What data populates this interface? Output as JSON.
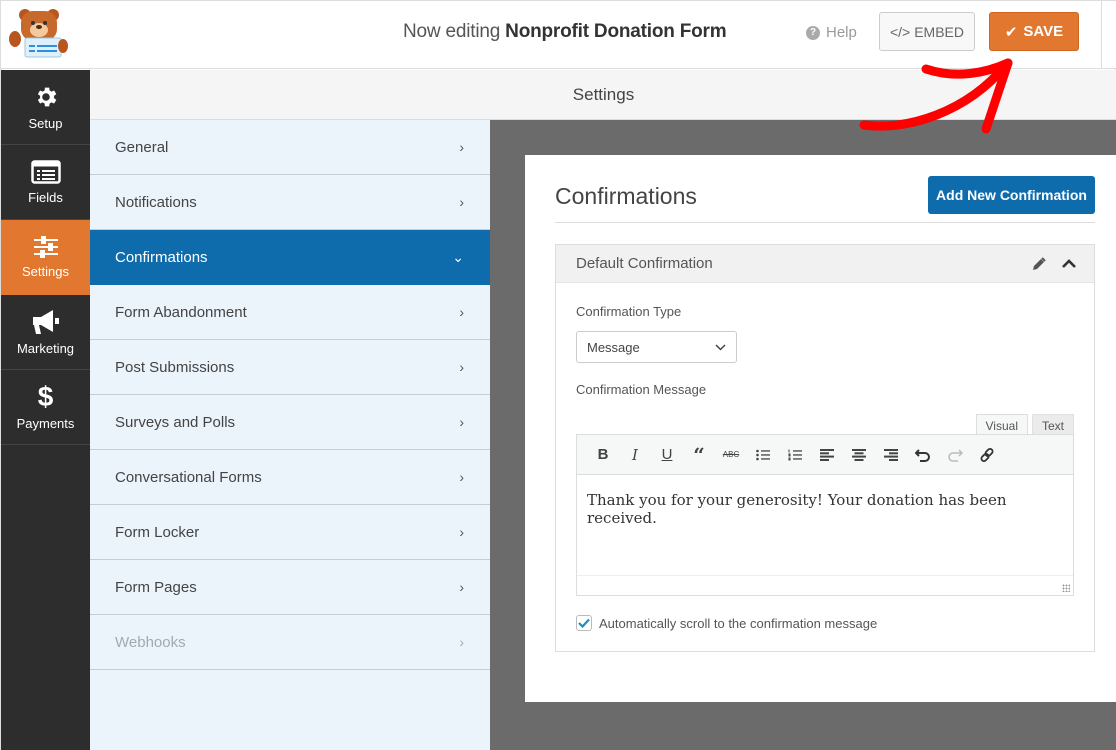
{
  "header": {
    "title_prefix": "Now editing",
    "form_name": "Nonprofit Donation Form",
    "help_label": "Help",
    "embed_label": "EMBED",
    "save_label": "SAVE"
  },
  "leftnav": {
    "items": [
      {
        "label": "Setup",
        "icon": "gear-icon",
        "active": false
      },
      {
        "label": "Fields",
        "icon": "fields-icon",
        "active": false
      },
      {
        "label": "Settings",
        "icon": "sliders-icon",
        "active": true
      },
      {
        "label": "Marketing",
        "icon": "megaphone-icon",
        "active": false
      },
      {
        "label": "Payments",
        "icon": "dollar-icon",
        "active": false
      }
    ]
  },
  "settings": {
    "heading": "Settings",
    "panels": [
      {
        "label": "General",
        "state": "normal"
      },
      {
        "label": "Notifications",
        "state": "normal"
      },
      {
        "label": "Confirmations",
        "state": "active"
      },
      {
        "label": "Form Abandonment",
        "state": "normal"
      },
      {
        "label": "Post Submissions",
        "state": "normal"
      },
      {
        "label": "Surveys and Polls",
        "state": "normal"
      },
      {
        "label": "Conversational Forms",
        "state": "normal"
      },
      {
        "label": "Form Locker",
        "state": "normal"
      },
      {
        "label": "Form Pages",
        "state": "normal"
      },
      {
        "label": "Webhooks",
        "state": "disabled"
      }
    ]
  },
  "confirmations": {
    "title": "Confirmations",
    "add_button": "Add New Confirmation",
    "default": {
      "title": "Default Confirmation",
      "type_label": "Confirmation Type",
      "type_value": "Message",
      "message_label": "Confirmation Message",
      "editor_tabs": [
        "Visual",
        "Text"
      ],
      "active_tab": "Visual",
      "message_text": "Thank you for your generosity! Your donation has been received.",
      "auto_scroll_label": "Automatically scroll to the confirmation message",
      "auto_scroll_checked": true
    }
  },
  "colors": {
    "accent_orange": "#e27730",
    "primary_blue": "#0e6cad",
    "sidebar_dark": "#2d2d2d",
    "annotation_red": "#ff0000"
  }
}
